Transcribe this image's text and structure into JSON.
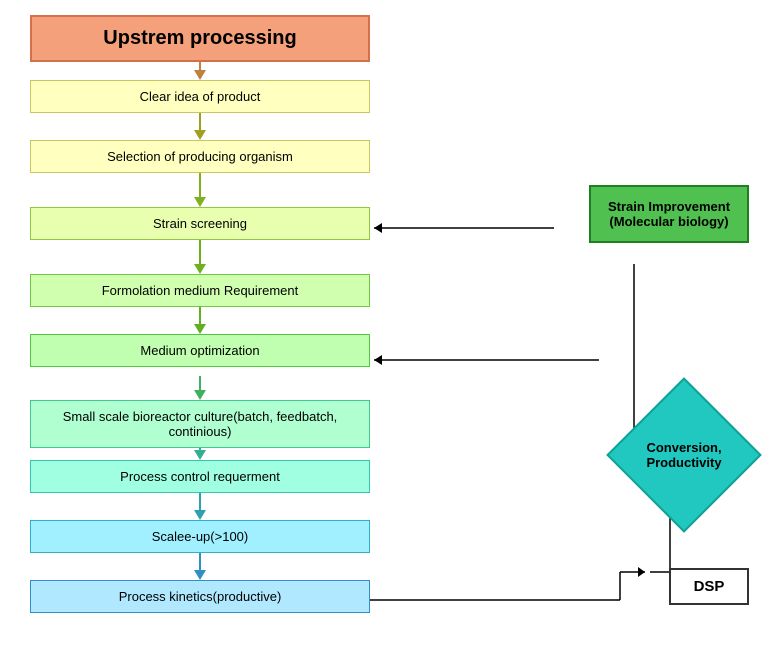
{
  "title": "Upstrem processing",
  "boxes": {
    "title": "Upstrem processing",
    "clear_idea": "Clear idea of product",
    "selection": "Selection of producing organism",
    "strain_screening": "Strain screening",
    "formulation": "Formolation medium Requirement",
    "medium_opt": "Medium optimization",
    "small_scale": "Small scale bioreactor culture(batch, feedbatch, continious)",
    "process_control": "Process control requerment",
    "scale_up": "Scalee-up(>100)",
    "process_kinetics": "Process kinetics(productive)"
  },
  "right_panel": {
    "strain_improvement": "Strain Improvement\n(Molecular biology)",
    "conversion": "Conversion,\nProductivity",
    "dsp": "DSP"
  }
}
